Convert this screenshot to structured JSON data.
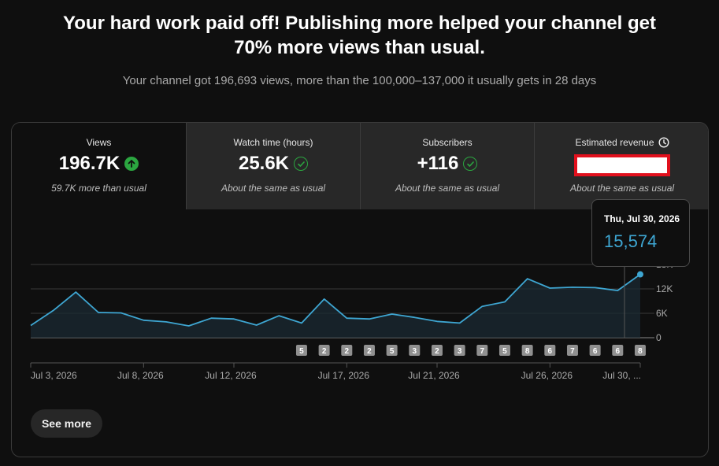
{
  "header": {
    "headline": "Your hard work paid off! Publishing more helped your channel get 70% more views than usual.",
    "subline": "Your channel got 196,693 views, more than the 100,000–137,000 it usually gets in 28 days"
  },
  "metrics": [
    {
      "label": "Views",
      "value": "196.7K",
      "note": "59.7K more than usual",
      "icon": "arrow-up-icon"
    },
    {
      "label": "Watch time (hours)",
      "value": "25.6K",
      "note": "About the same as usual",
      "icon": "check-circle-icon"
    },
    {
      "label": "Subscribers",
      "value": "+116",
      "note": "About the same as usual",
      "icon": "check-circle-icon"
    },
    {
      "label": "Estimated revenue",
      "value": "",
      "note": "About the same as usual",
      "icon": "clock-icon"
    }
  ],
  "tooltip": {
    "date": "Thu, Jul 30, 2026",
    "value": "15,574"
  },
  "see_more_label": "See more",
  "colors": {
    "line": "#3ea6d2",
    "positive": "#2ba640",
    "redaction_border": "#e1101d"
  },
  "chart_data": {
    "type": "line",
    "x": [
      "Jul 3, 2026",
      "Jul 4, 2026",
      "Jul 5, 2026",
      "Jul 6, 2026",
      "Jul 7, 2026",
      "Jul 8, 2026",
      "Jul 9, 2026",
      "Jul 10, 2026",
      "Jul 11, 2026",
      "Jul 12, 2026",
      "Jul 13, 2026",
      "Jul 14, 2026",
      "Jul 15, 2026",
      "Jul 16, 2026",
      "Jul 17, 2026",
      "Jul 18, 2026",
      "Jul 19, 2026",
      "Jul 20, 2026",
      "Jul 21, 2026",
      "Jul 22, 2026",
      "Jul 23, 2026",
      "Jul 24, 2026",
      "Jul 25, 2026",
      "Jul 26, 2026",
      "Jul 27, 2026",
      "Jul 28, 2026",
      "Jul 29, 2026",
      "Jul 30, 2026"
    ],
    "series": [
      {
        "values": [
          3000,
          6700,
          11200,
          6200,
          6100,
          4300,
          3900,
          2900,
          4800,
          4600,
          3100,
          5400,
          3600,
          9500,
          4800,
          4600,
          5800,
          5000,
          4000,
          3600,
          7700,
          8800,
          14500,
          12200,
          12400,
          12300,
          11600,
          15574
        ]
      }
    ],
    "x_tick_labels": [
      "Jul 3, 2026",
      "Jul 8, 2026",
      "Jul 12, 2026",
      "Jul 17, 2026",
      "Jul 21, 2026",
      "Jul 26, 2026",
      "Jul 30, ..."
    ],
    "x_tick_dates": [
      "Jul 3, 2026",
      "Jul 8, 2026",
      "Jul 12, 2026",
      "Jul 17, 2026",
      "Jul 21, 2026",
      "Jul 26, 2026",
      "Jul 30, 2026"
    ],
    "y_tick_labels": [
      "0",
      "6K",
      "12K",
      "18K"
    ],
    "y_ticks": [
      0,
      6000,
      12000,
      18000
    ],
    "ylim": [
      0,
      18000
    ],
    "uploads": [
      {
        "x": "Jul 16, 2026",
        "count": "5"
      },
      {
        "x": "Jul 17, 2026",
        "count": "2"
      },
      {
        "x": "Jul 18, 2026",
        "count": "2"
      },
      {
        "x": "Jul 19, 2026",
        "count": "2"
      },
      {
        "x": "Jul 20, 2026",
        "count": "5"
      },
      {
        "x": "Jul 21, 2026",
        "count": "3"
      },
      {
        "x": "Jul 22, 2026",
        "count": "2"
      },
      {
        "x": "Jul 23, 2026",
        "count": "3"
      },
      {
        "x": "Jul 24, 2026",
        "count": "7"
      },
      {
        "x": "Jul 25, 2026",
        "count": "5"
      },
      {
        "x": "Jul 26, 2026",
        "count": "8"
      },
      {
        "x": "Jul 27, 2026",
        "count": "6"
      },
      {
        "x": "Jul 28, 2026",
        "count": "7"
      },
      {
        "x": "Jul 29, 2026",
        "count": "6"
      },
      {
        "x": "Jul 30, 2026",
        "count": "6"
      },
      {
        "x": "Jul 31, 2026",
        "count": "8"
      }
    ],
    "grid": true,
    "highlight_x": "Jul 30, 2026"
  }
}
